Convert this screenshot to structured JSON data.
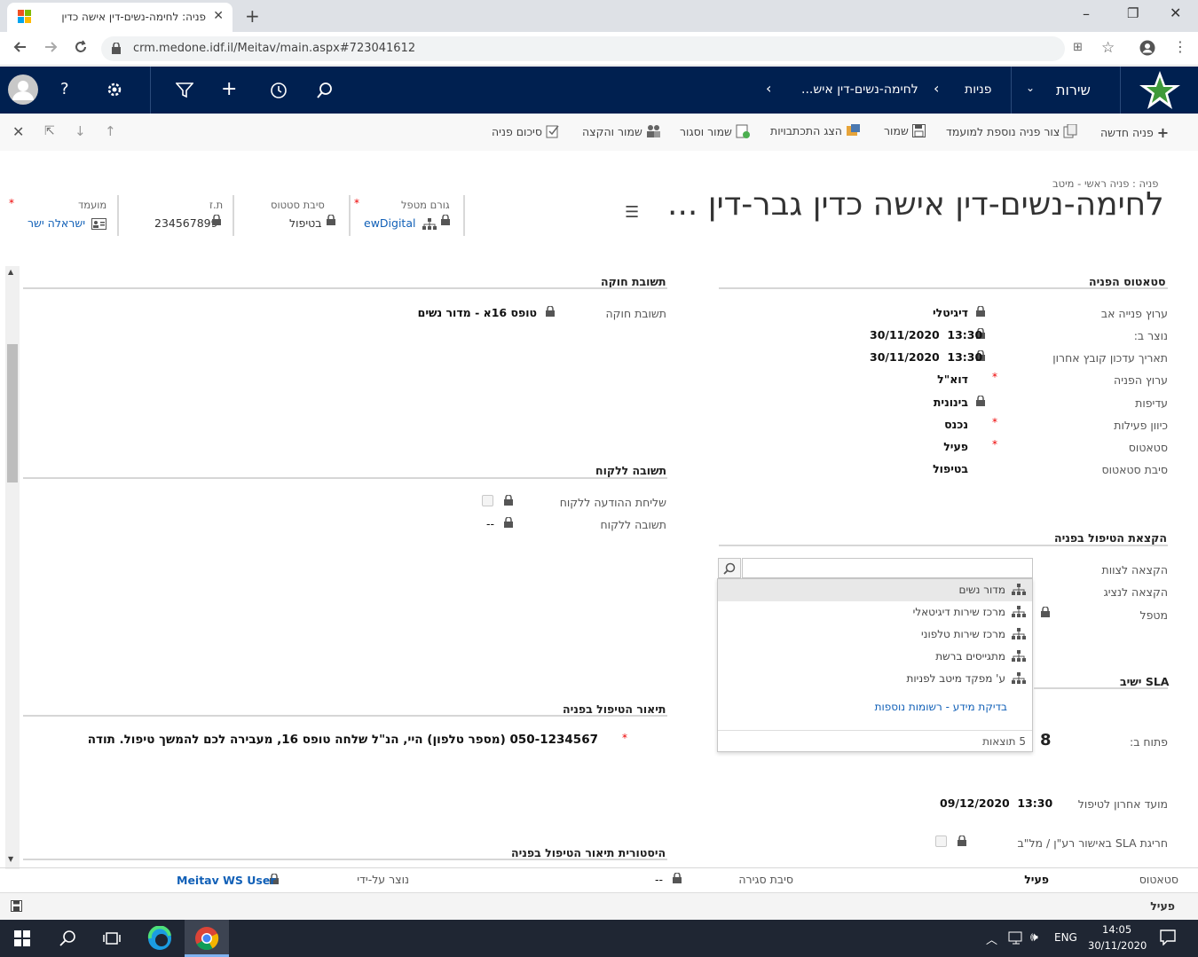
{
  "browser": {
    "tab_title": "פניה: לחימה-נשים-דין אישה כדין",
    "url": "crm.medone.idf.il/Meitav/main.aspx#723041612",
    "new_tab_symbol": "+",
    "window_controls": [
      "–",
      "❐",
      "✕"
    ]
  },
  "nav": {
    "area": "שירות",
    "entity": "פניות",
    "record": "לחימה-נשים-דין איש...",
    "icons": [
      "user-avatar",
      "help",
      "settings",
      "filter",
      "add",
      "history",
      "search"
    ]
  },
  "commands": {
    "new_case": "פניה חדשה",
    "create_child": "צור פניה נוספת למועמד",
    "save": "שמור",
    "show_correspondence": "הצג התכתבויות",
    "save_close": "שמור וסגור",
    "save_assign": "שמור והקצה",
    "resolve": "סיכום פניה"
  },
  "header": {
    "breadcrumb": "פניה : פניה ראשי - מיטב",
    "title": "לחימה-נשים-דין אישה כדין גבר-דין ...",
    "fields": [
      {
        "label": "גורם מטפל",
        "value": "ewDigital"
      },
      {
        "label": "סיבת סטטוס",
        "value": "בטיפול"
      },
      {
        "label": "ת.ז",
        "value": "234567899"
      },
      {
        "label": "מועמד",
        "value": "ישראלה ישר"
      }
    ]
  },
  "status_section": {
    "title": "סטאטוס הפניה",
    "rows": [
      {
        "label": "ערוץ פנייה אב",
        "value": "דיגיטלי"
      },
      {
        "label": "נוצר ב:",
        "value": "30/11/2020  13:30"
      },
      {
        "label": "תאריך עדכון קובץ אחרון",
        "value": "30/11/2020  13:30"
      },
      {
        "label": "ערוץ הפניה",
        "value": "דוא\"ל"
      },
      {
        "label": "עדיפות",
        "value": "בינונית"
      },
      {
        "label": "כיוון פעילות",
        "value": "נכנס"
      },
      {
        "label": "סטאטוס",
        "value": "פעיל"
      },
      {
        "label": "סיבת סטאטוס",
        "value": "בטיפול"
      }
    ]
  },
  "legal": {
    "title": "תשובת חוקה",
    "label": "תשובת חוקה",
    "value": "טופס 16א - מדור נשים"
  },
  "customer_reply": {
    "title": "תשובה ללקוח",
    "send_label": "שליחת ההודעה ללקוח",
    "reply_label": "תשובה ללקוח",
    "reply_value": "--"
  },
  "assignment": {
    "title": "הקצאת הטיפול בפניה",
    "team_label": "הקצאה לצוות",
    "rep_label": "הקצאה לנציג",
    "owner_label": "מטפל",
    "search_value": "",
    "options": [
      "מדור נשים",
      "מרכז שירות דיגיטאלי",
      "מרכז שירות טלפוני",
      "מתגייסים ברשת",
      "ע' מפקד מיטב לפניות"
    ],
    "lookup_more": "בדיקת מידע - רשומות נוספות",
    "results_count": "5 תוצאות"
  },
  "sla": {
    "title": "SLA ישיב",
    "opened_label": "פתוח ב:",
    "opened_value": "8",
    "last_due_label": "מועד אחרון לטיפול",
    "last_due_value": "09/12/2020  13:30",
    "breach_label": "חריגת SLA באישור רע\"ן / מל\"ב"
  },
  "description": {
    "title": "תיאור הטיפול בפניה",
    "text": "050-1234567 (מספר טלפון) היי, הנ\"ל שלחה טופס 16, מעבירה לכם להמשך טיפול. תודה"
  },
  "history": {
    "title": "היסטורית תיאור הטיפול בפניה"
  },
  "footer": {
    "status_label": "סטאטוס",
    "status_value": "פעיל",
    "close_reason_label": "סיבת סגירה",
    "close_reason_value": "--",
    "created_by_label": "נוצר על-ידי",
    "created_by_value": "Meitav WS User",
    "bottom_status": "פעיל"
  },
  "taskbar": {
    "lang": "ENG",
    "time": "14:05",
    "date": "30/11/2020"
  },
  "colors": {
    "nav_bg": "#002050",
    "link": "#1160b7",
    "required": "#e00000"
  }
}
